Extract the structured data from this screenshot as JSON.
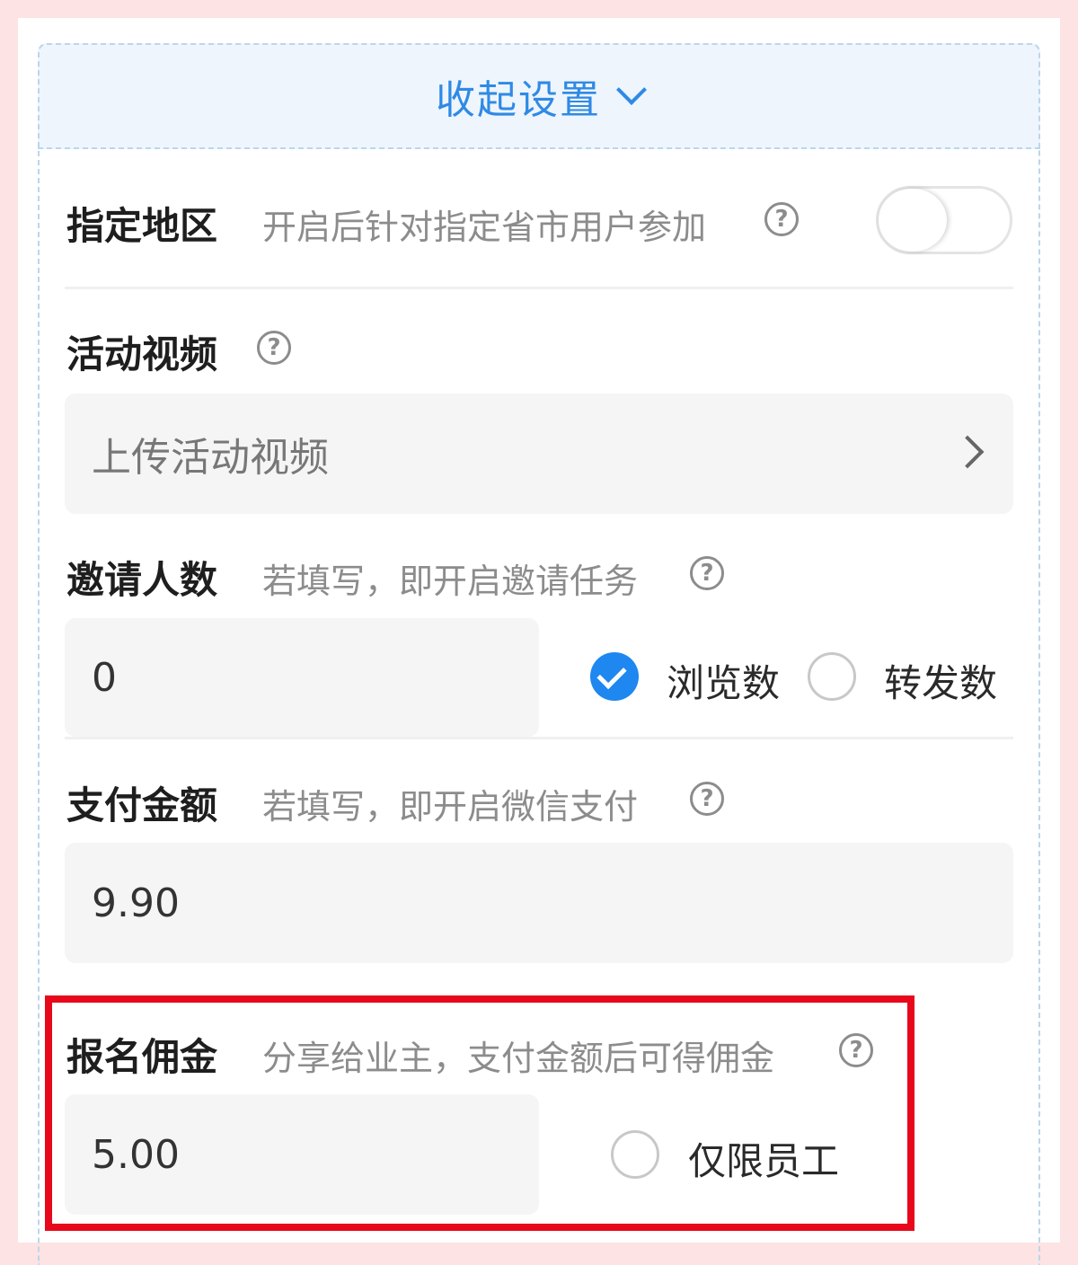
{
  "collapse": {
    "label": "收起设置"
  },
  "region": {
    "title": "指定地区",
    "hint": "开启后针对指定省市用户参加",
    "enabled": false
  },
  "video": {
    "title": "活动视频",
    "upload_label": "上传活动视频"
  },
  "invite": {
    "title": "邀请人数",
    "hint": "若填写，即开启邀请任务",
    "value": "0",
    "options": [
      "浏览数",
      "转发数"
    ],
    "selected": "浏览数"
  },
  "payment": {
    "title": "支付金额",
    "hint": "若填写，即开启微信支付",
    "value": "9.90"
  },
  "commission": {
    "title": "报名佣金",
    "hint": "分享给业主，支付金额后可得佣金",
    "value": "5.00",
    "staff_only_label": "仅限员工",
    "staff_only": false
  },
  "help_glyph": "?",
  "colors": {
    "accent": "#2f8ae5",
    "checked": "#1e87f0",
    "highlight": "#e8081b",
    "background": "#fde3e3"
  }
}
